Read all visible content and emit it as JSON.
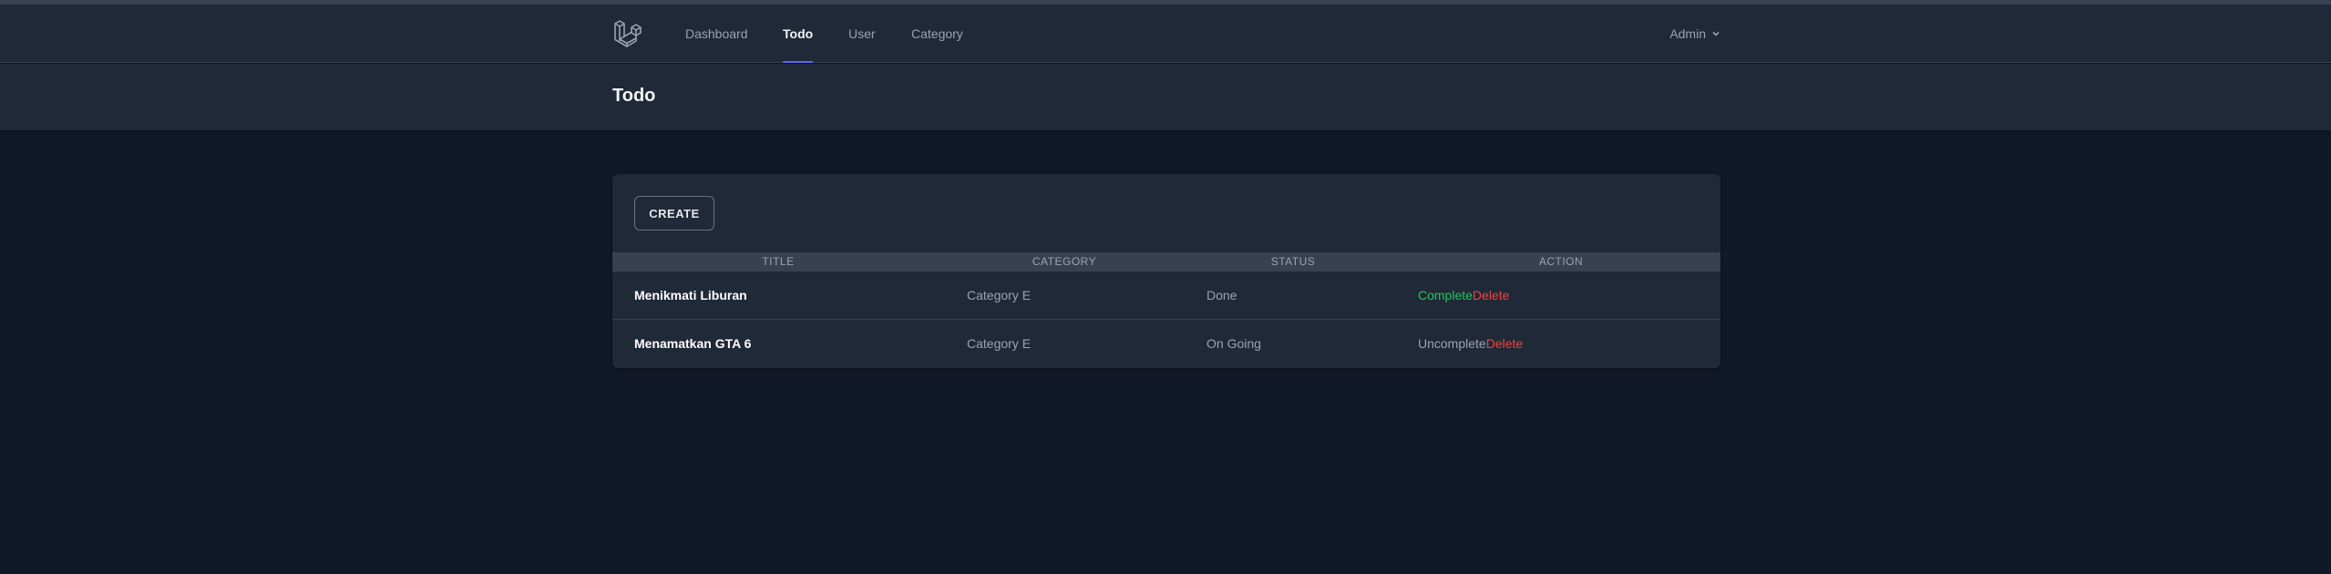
{
  "nav": {
    "links": [
      {
        "label": "Dashboard",
        "active": false
      },
      {
        "label": "Todo",
        "active": true
      },
      {
        "label": "User",
        "active": false
      },
      {
        "label": "Category",
        "active": false
      }
    ],
    "user_name": "Admin",
    "accent_color": "#6366f1"
  },
  "page": {
    "title": "Todo"
  },
  "toolbar": {
    "create_label": "CREATE"
  },
  "table": {
    "headers": [
      "Title",
      "Category",
      "Status",
      "Action"
    ],
    "rows": [
      {
        "title": "Menikmati Liburan",
        "category": "Category E",
        "status": "Done",
        "toggle_label": "Complete",
        "delete_label": "Delete"
      },
      {
        "title": "Menamatkan GTA 6",
        "category": "Category E",
        "status": "On Going",
        "toggle_label": "Uncomplete",
        "delete_label": "Delete"
      }
    ]
  },
  "colors": {
    "complete": "#22c55e",
    "delete": "#ef4444"
  }
}
